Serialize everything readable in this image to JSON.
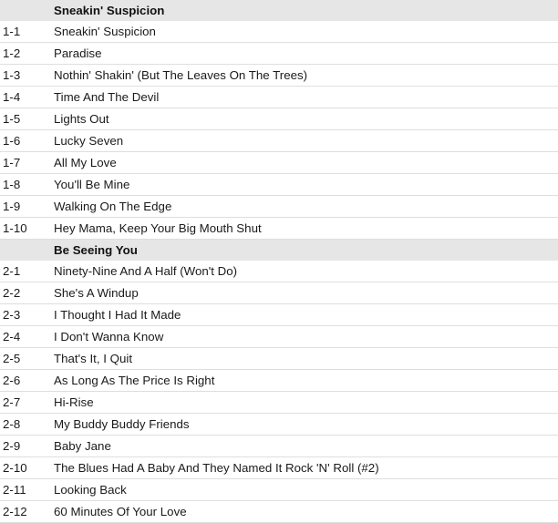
{
  "colors": {
    "section_header_bg": "#e6e6e6",
    "row_border": "#dedede",
    "page_bg": "#ffffff",
    "text": "#1a1a1a"
  },
  "columns": {
    "position_header": "",
    "title_header": ""
  },
  "sections": [
    {
      "name": "disc-1",
      "header": {
        "position": "",
        "title": "Sneakin' Suspicion"
      },
      "tracks": [
        {
          "position": "1-1",
          "title": "Sneakin' Suspicion"
        },
        {
          "position": "1-2",
          "title": "Paradise"
        },
        {
          "position": "1-3",
          "title": "Nothin' Shakin' (But The Leaves On The Trees)"
        },
        {
          "position": "1-4",
          "title": "Time And The Devil"
        },
        {
          "position": "1-5",
          "title": "Lights Out"
        },
        {
          "position": "1-6",
          "title": "Lucky Seven"
        },
        {
          "position": "1-7",
          "title": "All My Love"
        },
        {
          "position": "1-8",
          "title": "You'll Be Mine"
        },
        {
          "position": "1-9",
          "title": "Walking On The Edge"
        },
        {
          "position": "1-10",
          "title": "Hey Mama, Keep Your Big Mouth Shut"
        }
      ]
    },
    {
      "name": "disc-2",
      "header": {
        "position": "",
        "title": "Be Seeing You"
      },
      "tracks": [
        {
          "position": "2-1",
          "title": "Ninety-Nine And A Half (Won't Do)"
        },
        {
          "position": "2-2",
          "title": "She's A Windup"
        },
        {
          "position": "2-3",
          "title": "I Thought I Had It Made"
        },
        {
          "position": "2-4",
          "title": "I Don't Wanna Know"
        },
        {
          "position": "2-5",
          "title": "That's It, I Quit"
        },
        {
          "position": "2-6",
          "title": "As Long As The Price Is Right"
        },
        {
          "position": "2-7",
          "title": "Hi-Rise"
        },
        {
          "position": "2-8",
          "title": "My Buddy Buddy Friends"
        },
        {
          "position": "2-9",
          "title": "Baby Jane"
        },
        {
          "position": "2-10",
          "title": "The Blues Had A Baby And They Named It Rock 'N' Roll (#2)"
        },
        {
          "position": "2-11",
          "title": "Looking Back"
        },
        {
          "position": "2-12",
          "title": "60 Minutes Of Your Love"
        }
      ]
    }
  ]
}
